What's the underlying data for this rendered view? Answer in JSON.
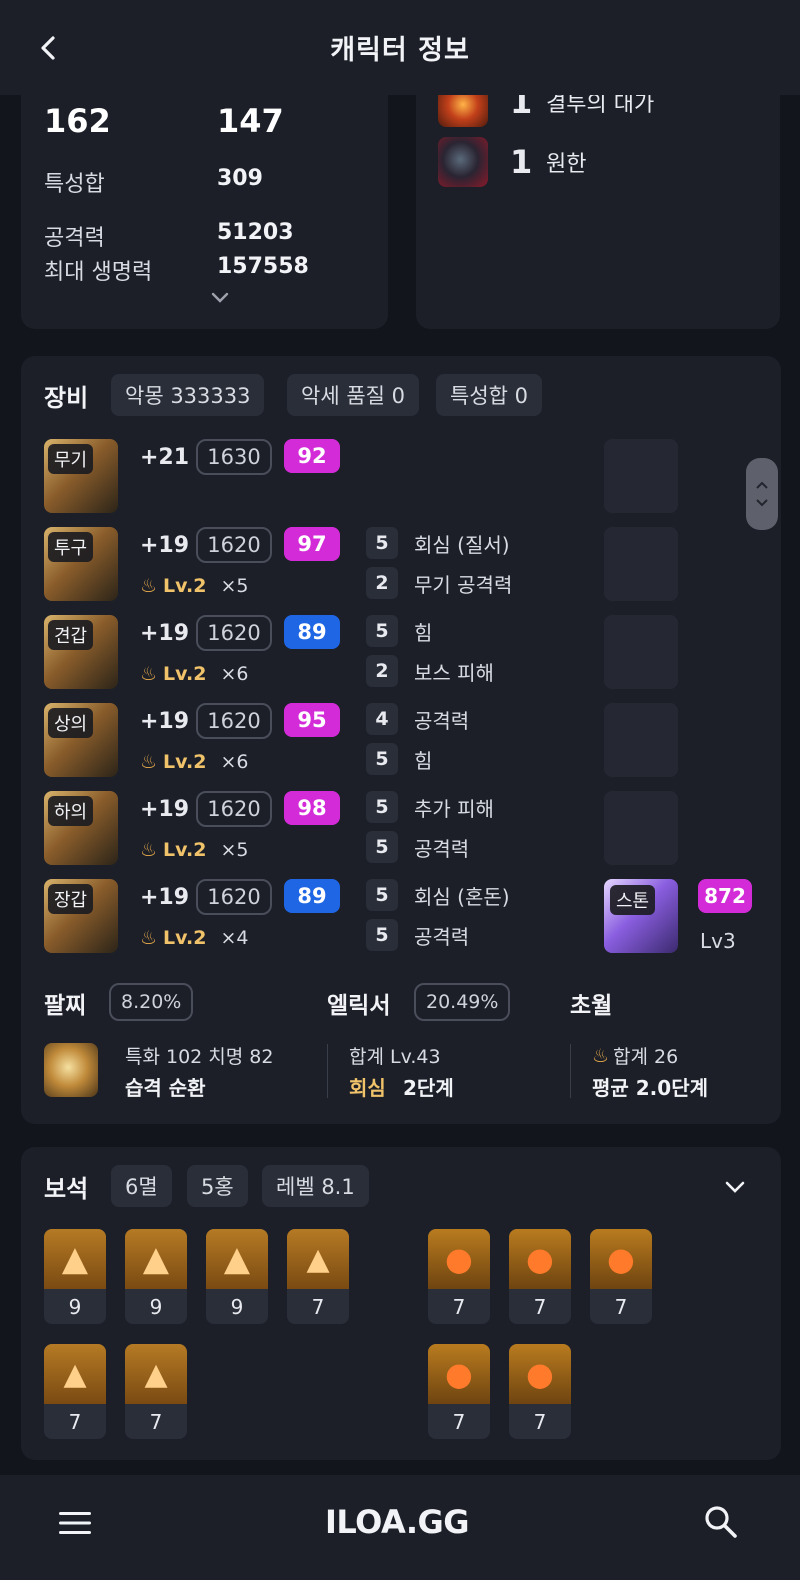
{
  "header": {
    "title": "캐릭터 정보"
  },
  "stats": {
    "top_left_value": "162",
    "top_right_value": "147",
    "rows": [
      {
        "label": "특성합",
        "value": "309"
      },
      {
        "label": "공격력",
        "value": "51203"
      },
      {
        "label": "최대 생명력",
        "value": "157558"
      }
    ]
  },
  "engravings": [
    {
      "count": "1",
      "name": "결투의 대가",
      "icon": "engraving-fire-icon"
    },
    {
      "count": "1",
      "name": "원한",
      "icon": "engraving-demon-icon"
    }
  ],
  "equipment": {
    "title": "장비",
    "pills": [
      "악몽 333333",
      "악세 품질 0",
      "특성합 0"
    ],
    "items": [
      {
        "slot": "무기",
        "plus": "+21",
        "ilvl": "1630",
        "quality": "92",
        "qcolor": "pink",
        "lv": "",
        "mult": "",
        "effects": []
      },
      {
        "slot": "투구",
        "plus": "+19",
        "ilvl": "1620",
        "quality": "97",
        "qcolor": "pink",
        "lv": "Lv.2",
        "mult": "×5",
        "effects": [
          {
            "n": "5",
            "name": "회심 (질서)"
          },
          {
            "n": "2",
            "name": "무기 공격력"
          }
        ]
      },
      {
        "slot": "견갑",
        "plus": "+19",
        "ilvl": "1620",
        "quality": "89",
        "qcolor": "blue",
        "lv": "Lv.2",
        "mult": "×6",
        "effects": [
          {
            "n": "5",
            "name": "힘"
          },
          {
            "n": "2",
            "name": "보스 피해"
          }
        ]
      },
      {
        "slot": "상의",
        "plus": "+19",
        "ilvl": "1620",
        "quality": "95",
        "qcolor": "pink",
        "lv": "Lv.2",
        "mult": "×6",
        "effects": [
          {
            "n": "4",
            "name": "공격력"
          },
          {
            "n": "5",
            "name": "힘"
          }
        ]
      },
      {
        "slot": "하의",
        "plus": "+19",
        "ilvl": "1620",
        "quality": "98",
        "qcolor": "pink",
        "lv": "Lv.2",
        "mult": "×5",
        "effects": [
          {
            "n": "5",
            "name": "추가 피해"
          },
          {
            "n": "5",
            "name": "공격력"
          }
        ]
      },
      {
        "slot": "장갑",
        "plus": "+19",
        "ilvl": "1620",
        "quality": "89",
        "qcolor": "blue",
        "lv": "Lv.2",
        "mult": "×4",
        "effects": [
          {
            "n": "5",
            "name": "회심 (혼돈)"
          },
          {
            "n": "5",
            "name": "공격력"
          }
        ]
      }
    ],
    "stone": {
      "tag": "스톤",
      "quality": "872",
      "lv": "Lv3"
    },
    "bracelet": {
      "title": "팔찌",
      "pct": "8.20%",
      "line1": "특화 102   치명 82",
      "line2": "습격   순환"
    },
    "elixir": {
      "title": "엘릭서",
      "pct": "20.49%",
      "line1": "합계 Lv.43",
      "line2_accent": "회심",
      "line2": "2단계"
    },
    "transcend": {
      "title": "초월",
      "line1": "합계 26",
      "line2": "평균 2.0단계"
    }
  },
  "gems": {
    "title": "보석",
    "pills": [
      "6멸",
      "5홍",
      "레벨 8.1"
    ],
    "left_row1": [
      "9",
      "9",
      "9",
      "7"
    ],
    "left_row2": [
      "7",
      "7"
    ],
    "right_row1": [
      "7",
      "7",
      "7"
    ],
    "right_row2": [
      "7",
      "7"
    ]
  },
  "footer": {
    "logo": "ILOA.GG"
  },
  "colors": {
    "bg": "#13151c",
    "card": "#1c1f28",
    "pink": "#d42bd9",
    "blue": "#1f66e5",
    "gold": "#f0c36a"
  }
}
